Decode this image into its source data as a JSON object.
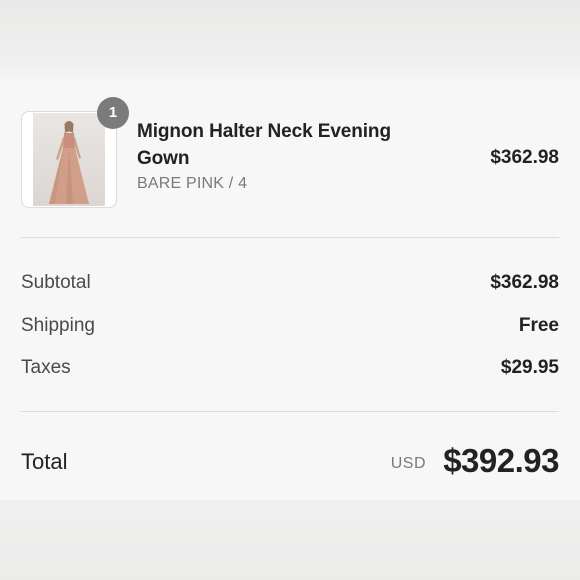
{
  "cart": {
    "item": {
      "quantity": "1",
      "name": "Mignon Halter Neck Evening Gown",
      "variant": "BARE PINK / 4",
      "price": "$362.98",
      "thumbnail_icon": "dress-product-photo"
    }
  },
  "summary": {
    "subtotal_label": "Subtotal",
    "subtotal_value": "$362.98",
    "shipping_label": "Shipping",
    "shipping_value": "Free",
    "taxes_label": "Taxes",
    "taxes_value": "$29.95"
  },
  "total": {
    "label": "Total",
    "currency": "USD",
    "value": "$392.93"
  },
  "colors": {
    "badge": "#7b7b7b",
    "text": "#222222",
    "muted": "#7a7a7a",
    "divider": "#dddddd"
  }
}
